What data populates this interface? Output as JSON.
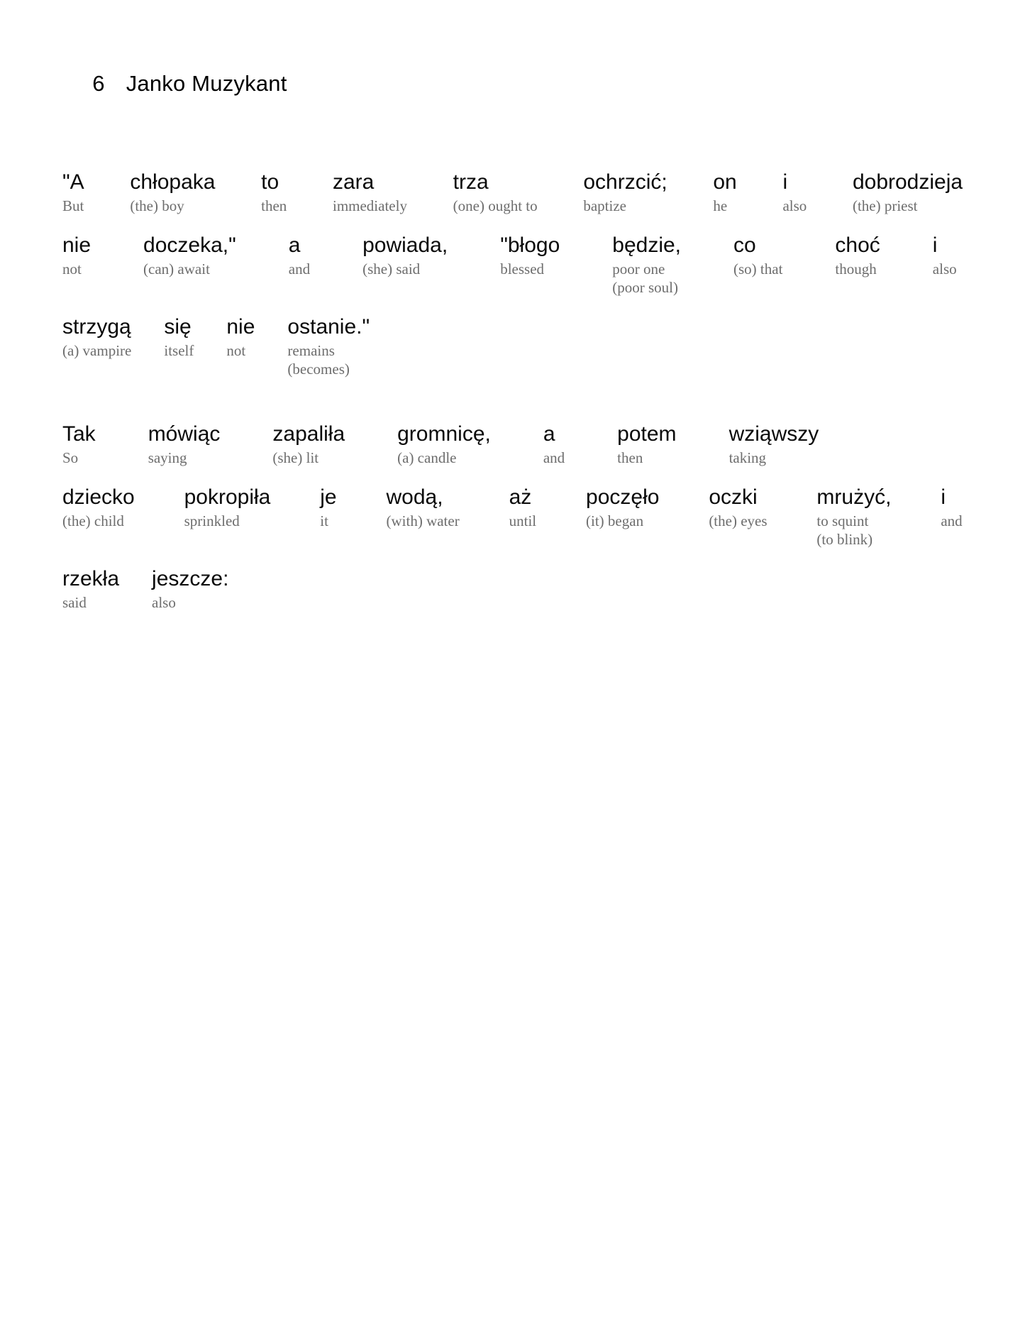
{
  "header": {
    "folio": "6",
    "title": "Janko Muzykant"
  },
  "colors": {
    "source_text": "#0a0a0a",
    "gloss_text": "#6d6d6d",
    "background": "#ffffff"
  },
  "stanzas": [
    {
      "id": "stanza-1",
      "lines": [
        {
          "id": "line-1",
          "pairs": [
            {
              "src": "\"A",
              "tgt": "But"
            },
            {
              "src": "chłopaka",
              "tgt": "(the) boy"
            },
            {
              "src": "to",
              "tgt": "then"
            },
            {
              "src": "zara",
              "tgt": "immediately"
            },
            {
              "src": "trza",
              "tgt": "(one) ought to"
            },
            {
              "src": "ochrzcić;",
              "tgt": "baptize"
            },
            {
              "src": "on",
              "tgt": "he"
            },
            {
              "src": "i",
              "tgt": "also"
            },
            {
              "src": "dobrodzieja",
              "tgt": "(the) priest"
            }
          ]
        },
        {
          "id": "line-2",
          "pairs": [
            {
              "src": "nie",
              "tgt": "not"
            },
            {
              "src": "doczeka,\"",
              "tgt": "(can) await"
            },
            {
              "src": "a",
              "tgt": "and"
            },
            {
              "src": "powiada,",
              "tgt": "(she) said"
            },
            {
              "src": "\"błogo",
              "tgt": "blessed"
            },
            {
              "src": "będzie,",
              "tgt": "poor one",
              "tgt_alt": "(poor soul)"
            },
            {
              "src": "co",
              "tgt": "(so) that"
            },
            {
              "src": "choć",
              "tgt": "though"
            },
            {
              "src": "i",
              "tgt": "also"
            }
          ]
        },
        {
          "id": "line-3",
          "pairs": [
            {
              "src": "strzygą",
              "tgt": "(a) vampire"
            },
            {
              "src": "się",
              "tgt": "itself"
            },
            {
              "src": "nie",
              "tgt": "not"
            },
            {
              "src": "ostanie.\"",
              "tgt": "remains",
              "tgt_alt": "(becomes)"
            }
          ]
        }
      ]
    },
    {
      "id": "stanza-2",
      "lines": [
        {
          "id": "line-4",
          "pairs": [
            {
              "src": "Tak",
              "tgt": "So"
            },
            {
              "src": "mówiąc",
              "tgt": "saying"
            },
            {
              "src": "zapaliła",
              "tgt": "(she) lit"
            },
            {
              "src": "gromnicę,",
              "tgt": "(a) candle"
            },
            {
              "src": "a",
              "tgt": "and"
            },
            {
              "src": "potem",
              "tgt": "then"
            },
            {
              "src": "wziąwszy",
              "tgt": "taking"
            }
          ]
        },
        {
          "id": "line-5",
          "pairs": [
            {
              "src": "dziecko",
              "tgt": "(the) child"
            },
            {
              "src": "pokropiła",
              "tgt": "sprinkled"
            },
            {
              "src": "je",
              "tgt": "it"
            },
            {
              "src": "wodą,",
              "tgt": "(with) water"
            },
            {
              "src": "aż",
              "tgt": "until"
            },
            {
              "src": "poczęło",
              "tgt": "(it) began"
            },
            {
              "src": "oczki",
              "tgt": "(the) eyes"
            },
            {
              "src": "mrużyć,",
              "tgt": "to squint",
              "tgt_alt": "(to blink)"
            },
            {
              "src": "i",
              "tgt": "and"
            }
          ]
        },
        {
          "id": "line-6",
          "pairs": [
            {
              "src": "rzekła",
              "tgt": "said"
            },
            {
              "src": "jeszcze:",
              "tgt": "also"
            }
          ]
        }
      ]
    }
  ]
}
